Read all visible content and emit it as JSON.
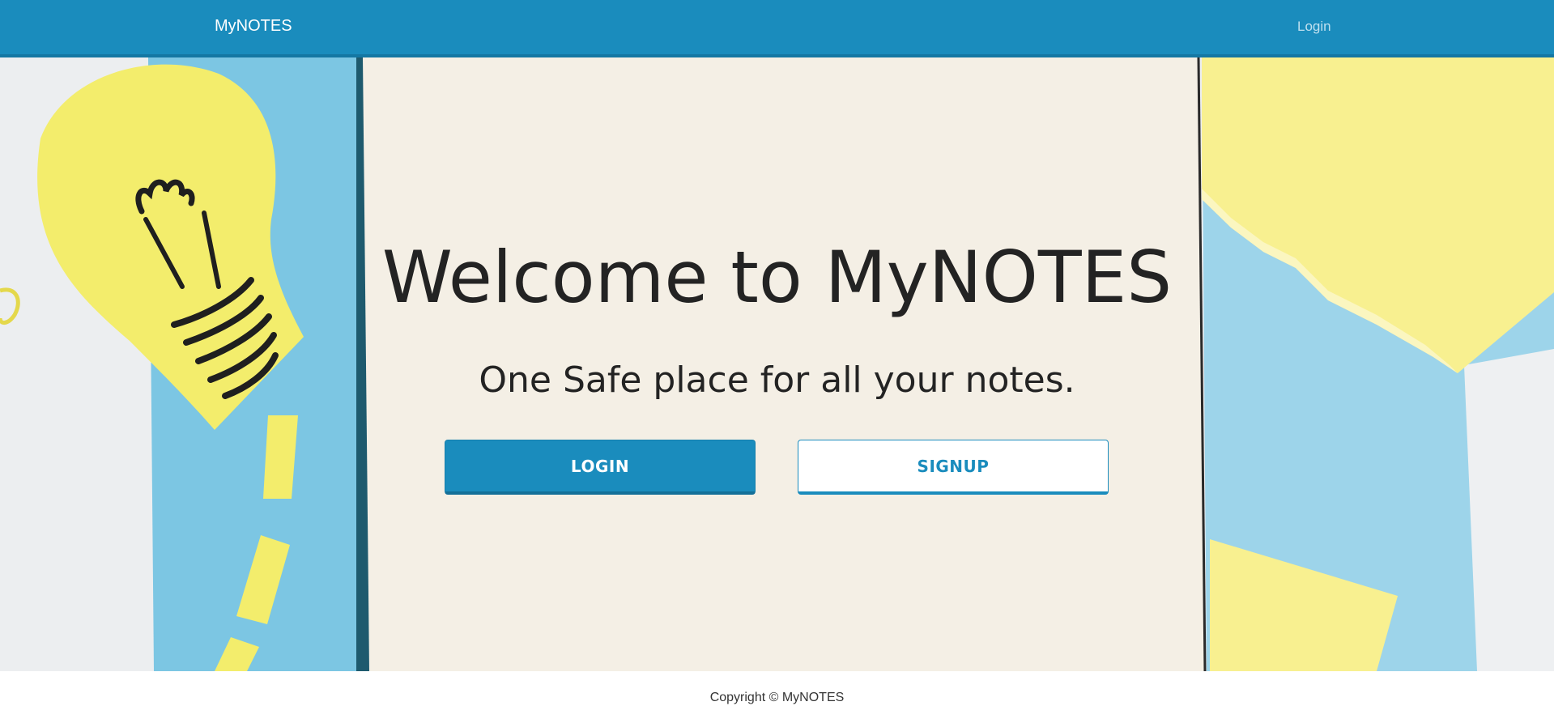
{
  "navbar": {
    "brand": "MyNOTES",
    "login_link": "Login"
  },
  "hero": {
    "title": "Welcome to MyNOTES",
    "subtitle": "One Safe place for all your notes.",
    "login_button": "LOGIN",
    "signup_button": "SIGNUP",
    "background_image": "lightbulb-paper-notebook-illustration"
  },
  "footer": {
    "copyright": "Copyright © MyNOTES"
  },
  "colors": {
    "primary": "#1a8cbd",
    "text": "#232323",
    "paper": "#f5f0e6",
    "sky_paper": "#8fd1ea",
    "yellow_paper": "#f5ef78"
  }
}
